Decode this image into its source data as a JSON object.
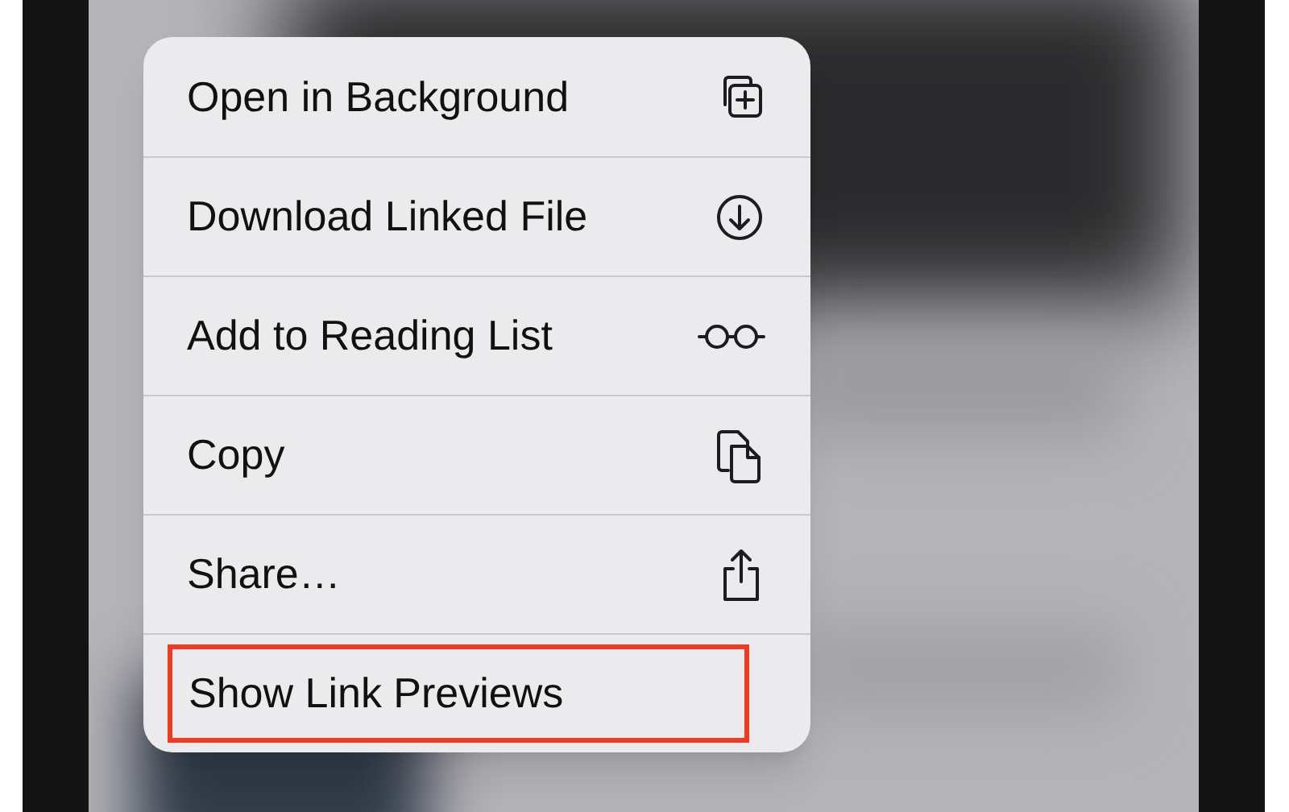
{
  "context_menu": {
    "items": [
      {
        "label": "Open in Background",
        "highlighted": false
      },
      {
        "label": "Download Linked File",
        "highlighted": false
      },
      {
        "label": "Add to Reading List",
        "highlighted": false
      },
      {
        "label": "Copy",
        "highlighted": false
      },
      {
        "label": "Share…",
        "highlighted": false
      },
      {
        "label": "Show Link Previews",
        "highlighted": true
      }
    ]
  }
}
